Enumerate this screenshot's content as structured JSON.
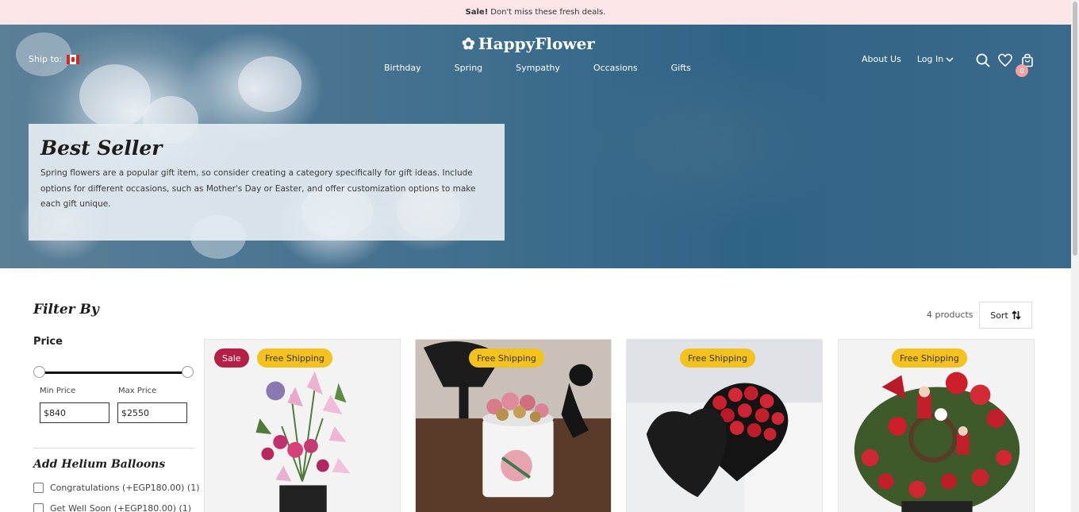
{
  "sale_bar": {
    "bold": "Sale!",
    "text": "Don't miss these fresh deals."
  },
  "header": {
    "brand": "HappyFlower",
    "ship_to": "Ship to:",
    "nav": [
      "Birthday",
      "Spring",
      "Sympathy",
      "Occasions",
      "Gifts"
    ],
    "about": "About Us",
    "login": "Log In",
    "cart_count": "0"
  },
  "hero": {
    "title": "Best Seller",
    "description": "Spring flowers are a popular gift item, so consider creating a category specifically for gift ideas. Include options for different occasions, such as Mother's Day or Easter, and offer customization options to make each gift unique."
  },
  "filter": {
    "title": "Filter By",
    "price_title": "Price",
    "min_label": "Min Price",
    "max_label": "Max Price",
    "min_value": "$840",
    "max_value": "$2550",
    "helium_title": "Add Helium Balloons",
    "helium_options": [
      "Congratulations (+EGP180.00) (1)",
      "Get Well Soon (+EGP180.00) (1)"
    ]
  },
  "products_header": {
    "count": "4 products",
    "sort": "Sort"
  },
  "products": [
    {
      "badges": [
        "Sale",
        "Free Shipping"
      ]
    },
    {
      "badges": [
        "Free Shipping"
      ]
    },
    {
      "badges": [
        "Free Shipping"
      ]
    },
    {
      "badges": [
        "Free Shipping"
      ]
    }
  ],
  "colors": {
    "sale_bar_bg": "#fce6e8",
    "sale_badge": "#b51f45",
    "free_badge": "#f4c21a",
    "hero_blue": "#3f6e8e",
    "cart_badge": "#f0a3a3"
  }
}
